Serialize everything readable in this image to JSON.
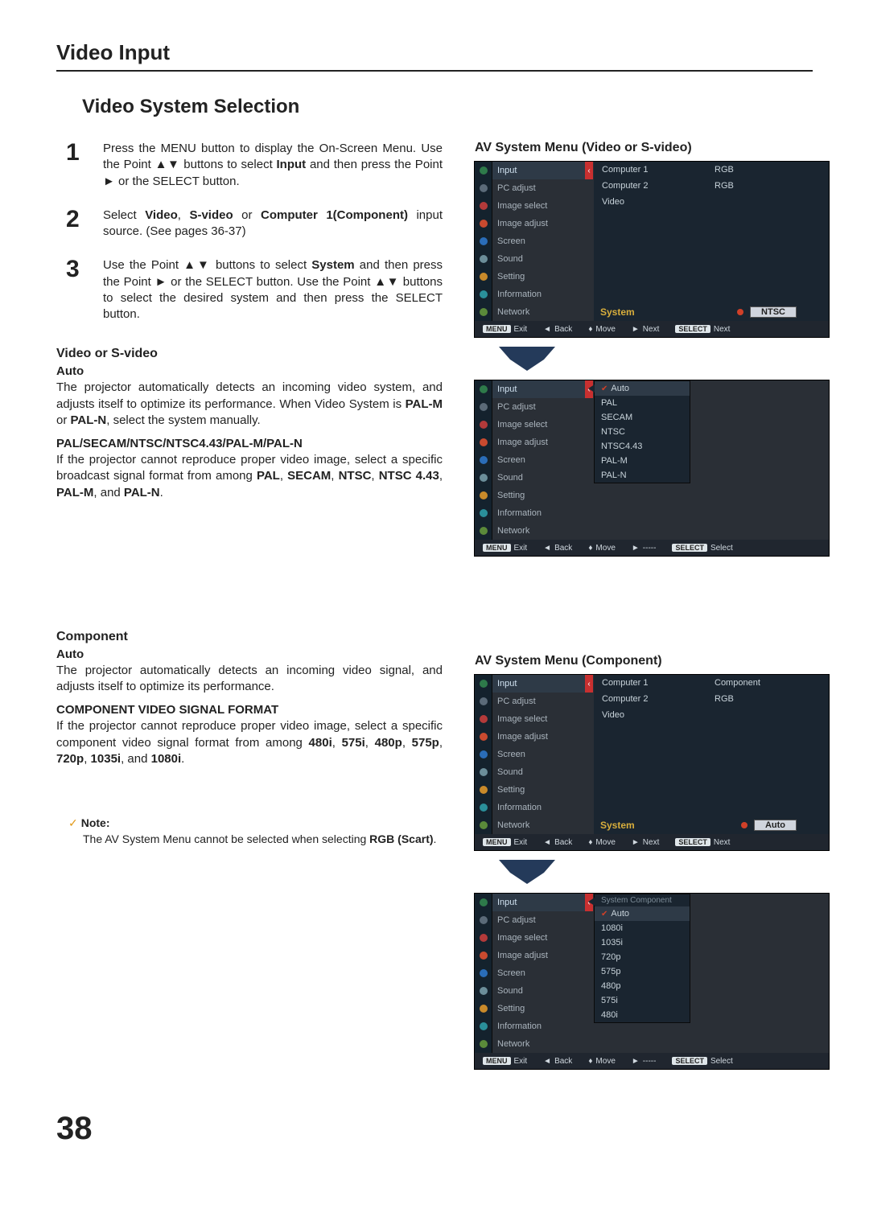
{
  "header": "Video Input",
  "subheader": "Video System Selection",
  "steps": [
    {
      "num": "1",
      "text": "Press the MENU button to display the On-Screen Menu. Use the Point ▲▼ buttons to select Input and then press the Point ► or the SELECT button.",
      "bold": [
        "Input"
      ]
    },
    {
      "num": "2",
      "text": "Select Video, S-video or Computer 1(Component) input source. (See pages 36-37)",
      "bold": [
        "Video",
        "S-video",
        "Computer 1(Component)"
      ]
    },
    {
      "num": "3",
      "text": "Use the Point ▲▼ buttons to select System and then press the Point ► or the SELECT button. Use the Point ▲▼ buttons to select the desired system and then press the SELECT button.",
      "bold": [
        "System"
      ]
    }
  ],
  "video_section": {
    "title": "Video or S-video",
    "auto_label": "Auto",
    "auto_text": "The projector automatically detects an incoming video system, and adjusts itself to optimize its performance. When Video System is PAL-M or PAL-N, select the system manually.",
    "formats_label": "PAL/SECAM/NTSC/NTSC4.43/PAL-M/PAL-N",
    "formats_text": "If the projector cannot reproduce proper video image, select a specific broadcast signal format from among PAL, SECAM, NTSC, NTSC 4.43, PAL-M, and PAL-N."
  },
  "component_section": {
    "title": "Component",
    "auto_label": "Auto",
    "auto_text": "The projector automatically detects an incoming video signal, and adjusts itself to optimize its performance.",
    "formats_label": "COMPONENT VIDEO SIGNAL FORMAT",
    "formats_text": "If the projector cannot reproduce proper video image, select a specific component video signal format from among 480i, 575i, 480p, 575p, 720p, 1035i, and 1080i."
  },
  "note": {
    "label": "Note:",
    "text": "The AV System Menu cannot be selected when selecting RGB (Scart)."
  },
  "osm_titles": {
    "video": "AV System Menu (Video or S-video)",
    "component": "AV System Menu (Component)"
  },
  "osm_menu_items": [
    "Input",
    "PC adjust",
    "Image select",
    "Image adjust",
    "Screen",
    "Sound",
    "Setting",
    "Information",
    "Network"
  ],
  "osm_video1": {
    "inputs": [
      {
        "name": "Computer 1",
        "mode": "RGB"
      },
      {
        "name": "Computer 2",
        "mode": "RGB"
      },
      {
        "name": "Video",
        "mode": ""
      }
    ],
    "system_label": "System",
    "system_value": "NTSC",
    "bottombar": [
      "Exit",
      "Back",
      "Move",
      "Next",
      "Next"
    ]
  },
  "osm_video2": {
    "dropdown_title": "",
    "dropdown": [
      "Auto",
      "PAL",
      "SECAM",
      "NTSC",
      "NTSC4.43",
      "PAL-M",
      "PAL-N"
    ],
    "bottombar": [
      "Exit",
      "Back",
      "Move",
      "-----",
      "Select"
    ]
  },
  "osm_comp1": {
    "inputs": [
      {
        "name": "Computer 1",
        "mode": "Component"
      },
      {
        "name": "Computer 2",
        "mode": "RGB"
      },
      {
        "name": "Video",
        "mode": ""
      }
    ],
    "system_label": "System",
    "system_value": "Auto",
    "bottombar": [
      "Exit",
      "Back",
      "Move",
      "Next",
      "Next"
    ]
  },
  "osm_comp2": {
    "dropdown_title": "System Component",
    "dropdown": [
      "Auto",
      "1080i",
      "1035i",
      "720p",
      "575p",
      "480p",
      "575i",
      "480i"
    ],
    "bottombar": [
      "Exit",
      "Back",
      "Move",
      "-----",
      "Select"
    ]
  },
  "page_number": "38"
}
